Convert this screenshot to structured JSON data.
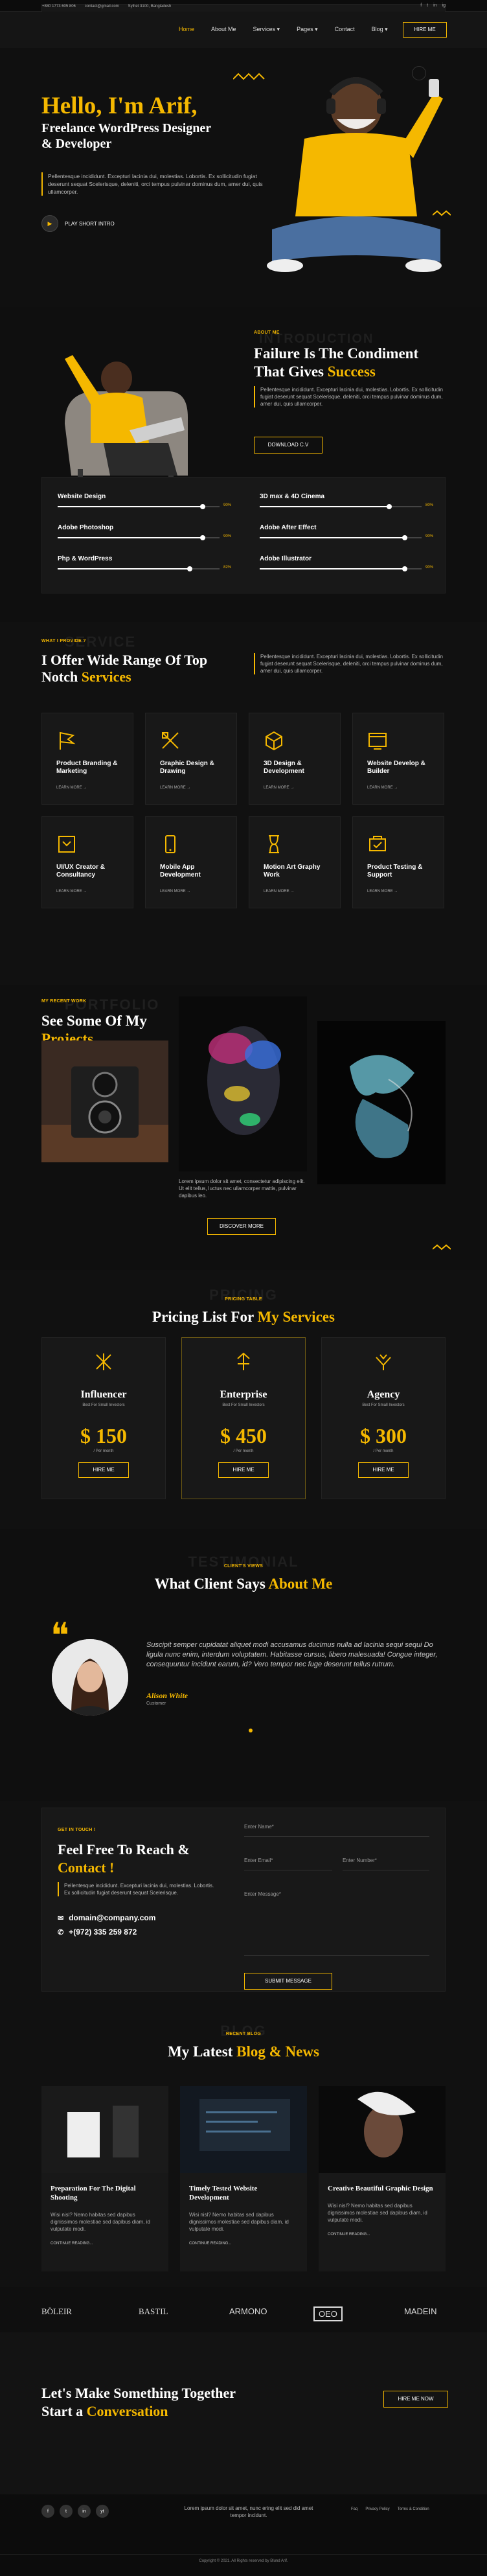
{
  "topbar": {
    "phone": "+880 1773 605 806",
    "email": "contact@gmail.com",
    "address": "Sylhet 3100, Bangladesh",
    "social": [
      "f",
      "t",
      "in",
      "ig"
    ]
  },
  "nav": {
    "items": [
      "Home",
      "About Me",
      "Services ▾",
      "Pages ▾",
      "Contact",
      "Blog ▾"
    ],
    "hire": "HIRE ME"
  },
  "hero": {
    "greeting": "Hello, I'm Arif,",
    "headline": "Freelance WordPress Designer & Developer",
    "desc": "Pellentesque incididunt. Excepturi lacinia dui, molestias. Lobortis. Ex sollicitudin fugiat deserunt sequat Scelerisque, deleniti, orci tempus pulvinar dominus dum, amer dui, quis ullamcorper.",
    "play": "PLAY SHORT INTRO"
  },
  "about": {
    "label": "ABOUT ME",
    "ghost": "INTRODUCTION",
    "title_1": "Failure Is The Condiment",
    "title_2": "That Gives ",
    "title_accent": "Success",
    "desc": "Pellentesque incididunt. Excepturi lacinia dui, molestias. Lobortis. Ex sollicitudin fugiat deserunt sequat Scelerisque, deleniti, orci tempus pulvinar dominus dum, amer dui, quis ullamcorper.",
    "download": "DOWNLOAD C.V",
    "skills": [
      {
        "name": "Website Design",
        "pct": "90%",
        "value": 0.9
      },
      {
        "name": "3D max & 4D Cinema",
        "pct": "80%",
        "value": 0.8
      },
      {
        "name": "Adobe Photoshop",
        "pct": "90%",
        "value": 0.9
      },
      {
        "name": "Adobe After Effect",
        "pct": "90%",
        "value": 0.9
      },
      {
        "name": "Php & WordPress",
        "pct": "82%",
        "value": 0.82
      },
      {
        "name": "Adobe Illustrator",
        "pct": "90%",
        "value": 0.9
      }
    ]
  },
  "services": {
    "label": "WHAT I PROVIDE ?",
    "ghost": "SERVICE",
    "title_1": "I Offer Wide Range Of Top",
    "title_2": "Notch ",
    "title_accent": "Services",
    "desc": "Pellentesque incididunt. Excepturi lacinia dui, molestias. Lobortis. Ex sollicitudin fugiat deserunt sequat Scelerisque, deleniti, orci tempus pulvinar dominus dum, amer dui, quis ullamcorper.",
    "items": [
      {
        "title": "Product Branding & Marketing",
        "icon": "flag-icon"
      },
      {
        "title": "Graphic Design & Drawing",
        "icon": "pen-tools-icon"
      },
      {
        "title": "3D Design & Development",
        "icon": "3d-cube-icon"
      },
      {
        "title": "Website Develop & Builder",
        "icon": "web-icon"
      },
      {
        "title": "UI/UX Creator & Consultancy",
        "icon": "ux-icon"
      },
      {
        "title": "Mobile App Development",
        "icon": "mobile-icon"
      },
      {
        "title": "Motion Art Graphy Work",
        "icon": "hourglass-icon"
      },
      {
        "title": "Product Testing & Support",
        "icon": "support-icon"
      }
    ],
    "more": "LEARN MORE →"
  },
  "projects": {
    "label": "MY RECENT WORK",
    "ghost": "PORTFOLIO",
    "title_1": "See Some Of My",
    "title_accent": "Projects",
    "caption": "Lorem ipsum dolor sit amet, consectetur adipiscing elit. Ut elit tellus, luctus nec ullamcorper mattis, pulvinar dapibus leo.",
    "discover": "DISCOVER MORE"
  },
  "pricing": {
    "label": "PRICING TABLE",
    "ghost": "PRICING",
    "title_1": "Pricing List For ",
    "title_accent": "My Services",
    "plans": [
      {
        "name": "Influencer",
        "sub": "Best For Small Investors",
        "price": "$ 150",
        "per": "/ Per month",
        "hire": "HIRE ME"
      },
      {
        "name": "Enterprise",
        "sub": "Best For Small Investors",
        "price": "$ 450",
        "per": "/ Per month",
        "hire": "HIRE ME"
      },
      {
        "name": "Agency",
        "sub": "Best For Small Investors",
        "price": "$ 300",
        "per": "/ Per month",
        "hire": "HIRE ME"
      }
    ]
  },
  "testimonial": {
    "label": "CLIENT'S VIEWS",
    "ghost": "TESTIMONIAL",
    "title_1": "What Client Says ",
    "title_accent": "About Me",
    "text": "Suscipit semper cupidatat aliquet modi accusamus ducimus nulla ad lacinia sequi sequi Do ligula nunc enim, interdum voluptatem. Habitasse cursus, libero malesuada! Congue integer, consequuntur incidunt earum, id? Vero tempor nec fuge deserunt tellus rutrum.",
    "name": "Alison White",
    "role": "Customer"
  },
  "contact": {
    "label": "GET IN TOUCH !",
    "title_1": "Feel Free To Reach &",
    "title_accent": "Contact !",
    "desc": "Pellentesque incididunt. Excepturi lacinia dui, molestias. Lobortis. Ex sollicitudin fugiat deserunt sequat Scelerisque.",
    "email": "domain@company.com",
    "phone": "+(972) 335 259 872",
    "f_name": "Enter Name*",
    "f_email": "Enter Email*",
    "f_number": "Enter Number*",
    "f_message": "Enter Message*",
    "submit": "SUBMIT MESSAGE"
  },
  "blog": {
    "label": "RECENT BLOG",
    "ghost": "BLOG",
    "title_1": "My Latest ",
    "title_accent": "Blog & News",
    "posts": [
      {
        "title": "Preparation For The Digital Shooting",
        "desc": "Wisi nisl? Nemo habitas sed dapibus dignissimos molestiae sed dapibus diam, id vulputate modi.",
        "more": "CONTINUE READING..."
      },
      {
        "title": "Timely Tested Website Development",
        "desc": "Wisi nisl? Nemo habitas sed dapibus dignissimos molestiae sed dapibus diam, id vulputate modi.",
        "more": "CONTINUE READING..."
      },
      {
        "title": "Creative Beautiful Graphic Design",
        "desc": "Wisi nisl? Nemo habitas sed dapibus dignissimos molestiae sed dapibus diam, id vulputate modi.",
        "more": "CONTINUE READING..."
      }
    ]
  },
  "logos": [
    "BÖLEIR",
    "BASTIL",
    "ARMONO",
    "OEO",
    "MADEIN"
  ],
  "cta": {
    "title_1": "Let's Make Something Together",
    "title_2": "Start a ",
    "title_accent": "Conversation",
    "hire": "HIRE ME NOW"
  },
  "footer": {
    "social": [
      "f",
      "t",
      "in",
      "yt"
    ],
    "text": "Lorem ipsum dolor sit amet, nunc ering elit sed did amet tempor incidunt.",
    "links": [
      "Faq",
      "Privacy Policy",
      "Terms & Condition"
    ],
    "copy": "Copyright © 2021. All Rights reserved by Blund Arif."
  },
  "colors": {
    "accent": "#f5b800",
    "bg": "#111111",
    "card": "#181818"
  }
}
